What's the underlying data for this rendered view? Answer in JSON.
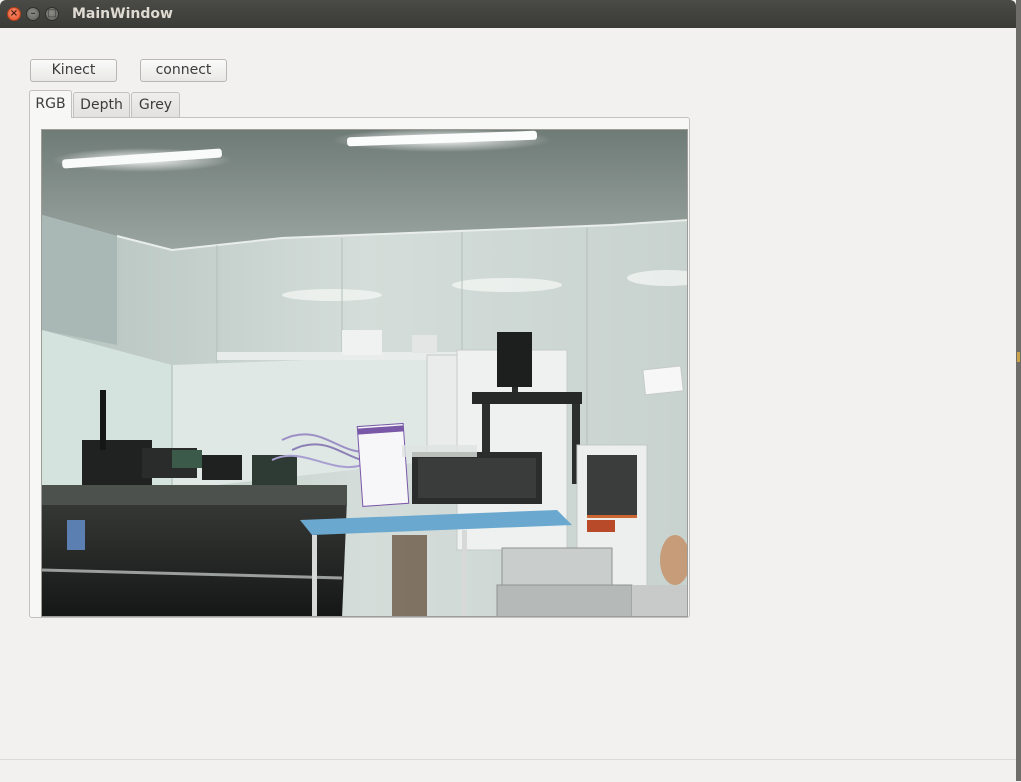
{
  "window": {
    "title": "MainWindow"
  },
  "toolbar": {
    "kinect_label": "Kinect",
    "connect_label": "connect"
  },
  "tabs": [
    {
      "label": "RGB",
      "active": true
    },
    {
      "label": "Depth",
      "active": false
    },
    {
      "label": "Grey",
      "active": false
    }
  ],
  "colors": {
    "titlebar": "#3c3b37",
    "close_button": "#e5542b",
    "window_bg": "#f2f1f0"
  },
  "icons": {
    "close": "close-icon",
    "minimize": "minimize-icon",
    "maximize": "maximize-icon"
  }
}
